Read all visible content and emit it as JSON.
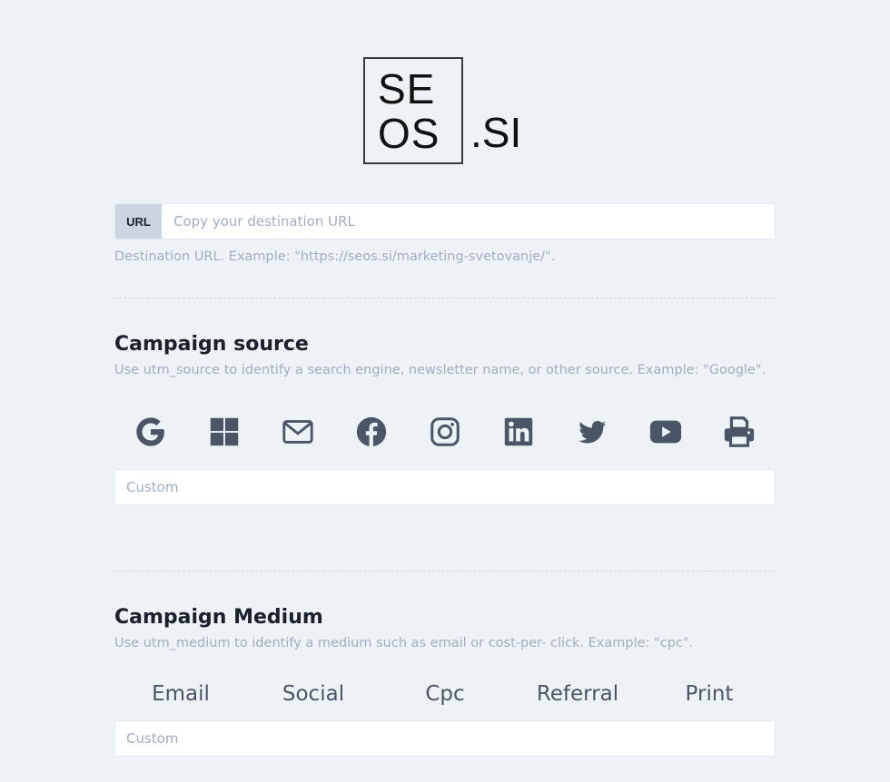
{
  "logo": {
    "line1": "SE",
    "line2": "OS",
    "suffix": ".SI"
  },
  "url": {
    "tag": "URL",
    "placeholder": "Copy your destination URL",
    "help": "Destination URL. Example: \"https://seos.si/marketing-svetovanje/\"."
  },
  "source": {
    "title": "Campaign source",
    "help": "Use utm_source to identify a search engine, newsletter name, or other source. Example: \"Google\".",
    "icons": [
      "google-icon",
      "windows-icon",
      "email-icon",
      "facebook-icon",
      "instagram-icon",
      "linkedin-icon",
      "twitter-icon",
      "youtube-icon",
      "print-icon"
    ],
    "custom_placeholder": "Custom"
  },
  "medium": {
    "title": "Campaign Medium",
    "help": "Use utm_medium to identify a medium such as email or cost-per- click. Example: \"cpc\".",
    "options": [
      "Email",
      "Social",
      "Cpc",
      "Referral",
      "Print"
    ],
    "custom_placeholder": "Custom"
  },
  "colors": {
    "background": "#edf2f7",
    "icon": "#4a5568",
    "muted": "#a0aec0",
    "tag_bg": "#cbd5e0"
  }
}
